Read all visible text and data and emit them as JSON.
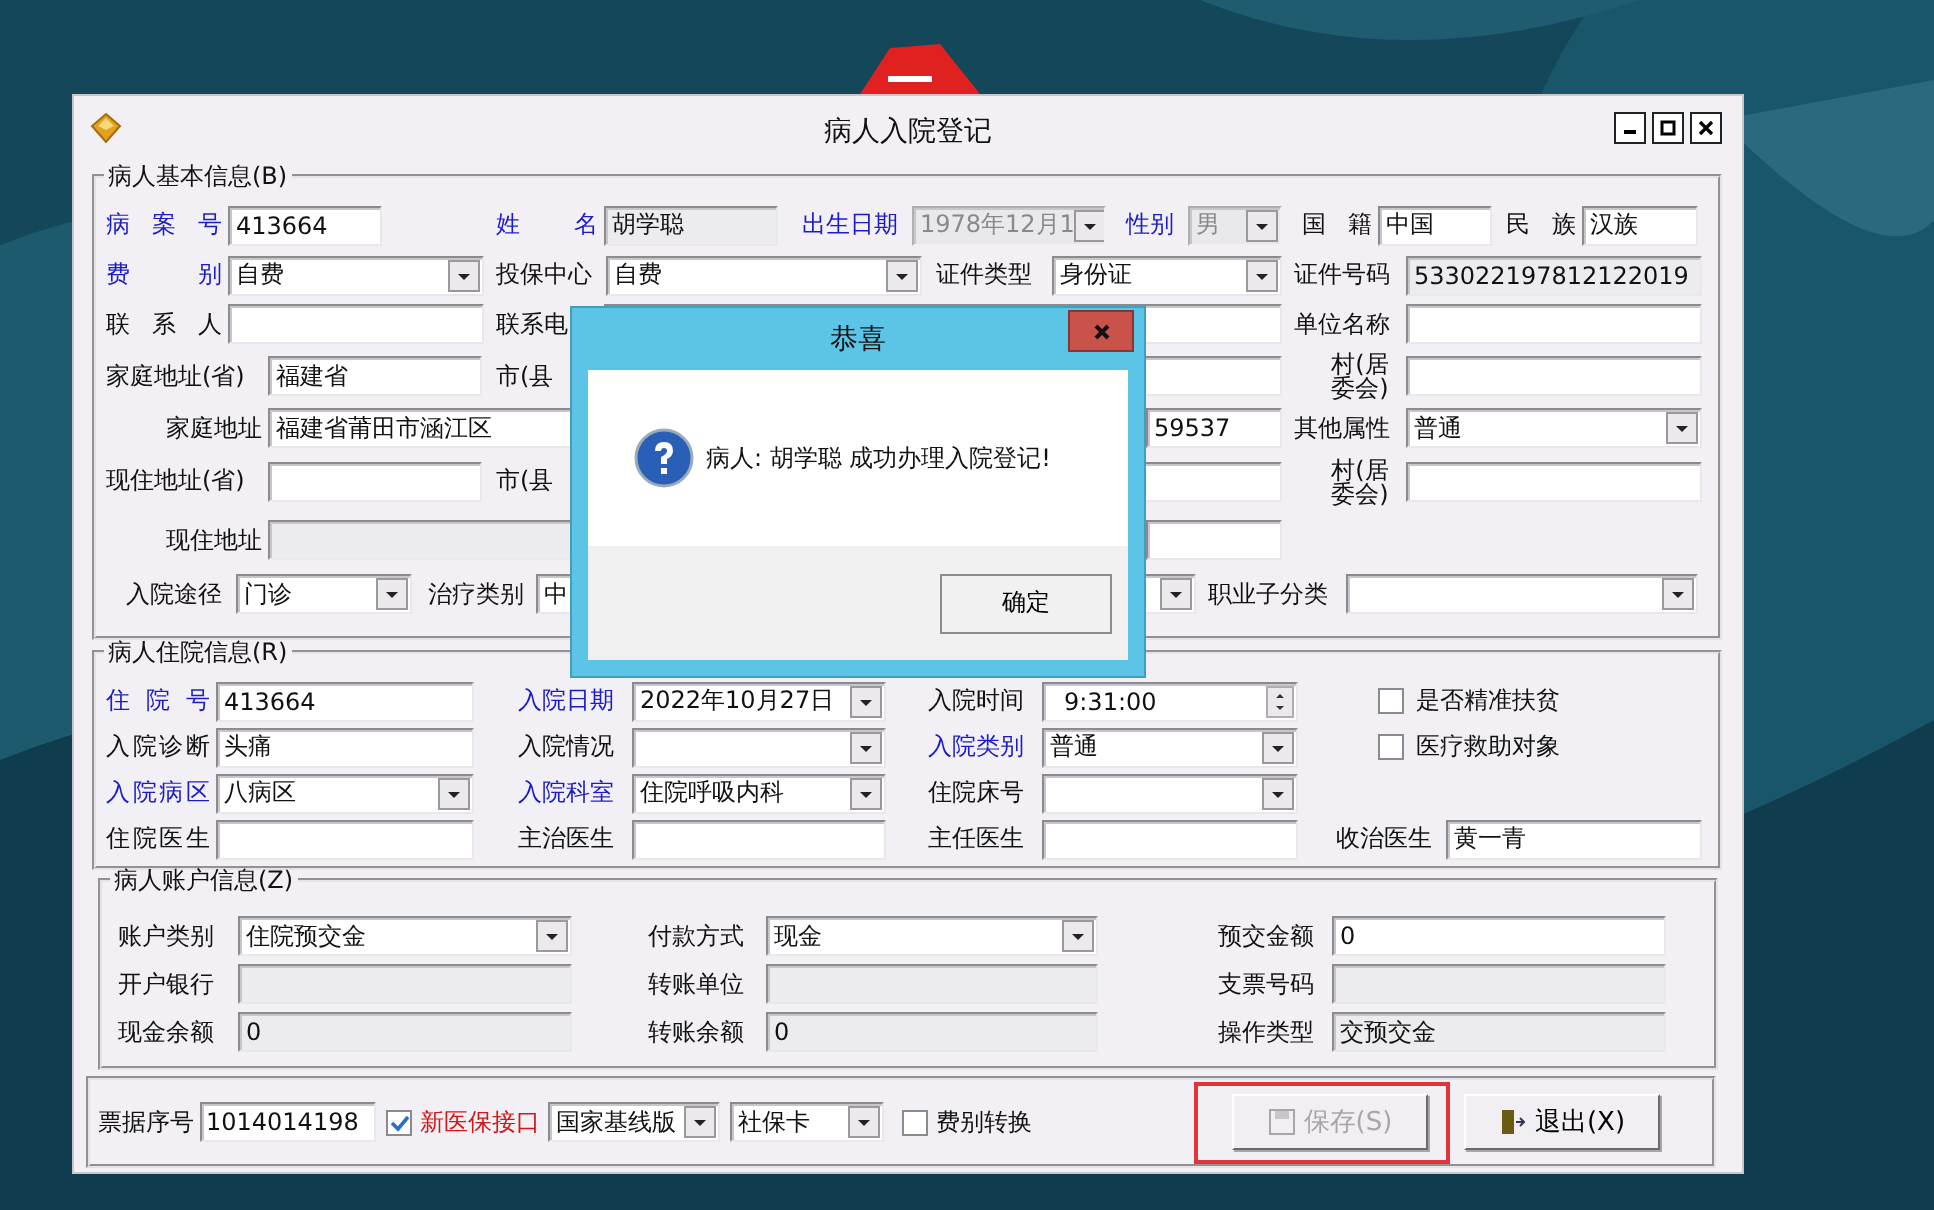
{
  "window": {
    "title": "病人入院登记"
  },
  "basic_info": {
    "title": "病人基本信息(B)",
    "lines": [
      {
        "fields": [
          {
            "label": "病 案 号",
            "highlighted": true,
            "kind": "text",
            "value": "413664",
            "readonly": false,
            "disabled": false
          },
          {
            "label": "姓 名",
            "highlighted": true,
            "kind": "text",
            "value": "胡学聪",
            "readonly": true,
            "disabled": false
          },
          {
            "label": "出生日期",
            "highlighted": true,
            "kind": "combo",
            "value": "1978年12月1",
            "readonly": false,
            "disabled": true
          },
          {
            "label": "性别",
            "highlighted": true,
            "kind": "combo",
            "value": "男",
            "readonly": false,
            "disabled": true
          },
          {
            "label": "国 籍",
            "highlighted": false,
            "kind": "text",
            "value": "中国",
            "readonly": false,
            "disabled": false
          },
          {
            "label": "民 族",
            "highlighted": false,
            "kind": "text",
            "value": "汉族",
            "readonly": false,
            "disabled": false
          }
        ]
      },
      {
        "fields": [
          {
            "label": "费 别",
            "highlighted": true,
            "kind": "combo",
            "value": "自费",
            "readonly": false,
            "disabled": false
          },
          {
            "label": "投保中心",
            "highlighted": false,
            "kind": "combo",
            "value": "自费",
            "readonly": false,
            "disabled": false
          },
          {
            "label": "证件类型",
            "highlighted": false,
            "kind": "combo",
            "value": "身份证",
            "readonly": false,
            "disabled": false
          },
          {
            "label": "证件号码",
            "highlighted": false,
            "kind": "text",
            "value": "533022197812122019",
            "readonly": true,
            "disabled": false
          }
        ]
      },
      {
        "fields": [
          {
            "label": "联 系 人",
            "highlighted": false,
            "kind": "text",
            "readonly": false,
            "disabled": false
          },
          {
            "label": "联系电",
            "highlighted": false,
            "kind": "text",
            "readonly": false,
            "disabled": false
          },
          {
            "label": "单位名称",
            "highlighted": false,
            "kind": "text",
            "readonly": false,
            "disabled": false
          }
        ]
      },
      {
        "fields": [
          {
            "label": "家庭地址(省)",
            "highlighted": false,
            "kind": "text",
            "value": "福建省",
            "readonly": false,
            "disabled": false
          },
          {
            "label": "市(县",
            "highlighted": false,
            "kind": "text",
            "readonly": false,
            "disabled": false
          },
          {
            "label": "村(居委会)",
            "highlighted": false,
            "kind": "text",
            "readonly": false,
            "disabled": false
          }
        ]
      },
      {
        "fields": [
          {
            "label": "家庭地址",
            "highlighted": false,
            "kind": "text",
            "value": "福建省莆田市涵江区",
            "readonly": false,
            "disabled": false
          },
          {
            "kind": "text",
            "value": "59537",
            "readonly": false,
            "disabled": false
          },
          {
            "label": "其他属性",
            "highlighted": false,
            "kind": "combo",
            "value": "普通",
            "readonly": false,
            "disabled": false
          }
        ]
      },
      {
        "fields": [
          {
            "label": "现住地址(省)",
            "highlighted": false,
            "kind": "text",
            "readonly": false,
            "disabled": false
          },
          {
            "label": "市(县",
            "highlighted": false,
            "kind": "text",
            "readonly": false,
            "disabled": false
          },
          {
            "label": "村(居委会)",
            "highlighted": false,
            "kind": "text",
            "readonly": false,
            "disabled": false
          }
        ]
      },
      {
        "fields": [
          {
            "label": "现住地址",
            "highlighted": false,
            "kind": "text",
            "readonly": true,
            "disabled": false
          },
          {
            "kind": "text",
            "readonly": false,
            "disabled": false
          }
        ]
      },
      {
        "fields": [
          {
            "label": "入院途径",
            "highlighted": false,
            "kind": "combo",
            "value": "门诊",
            "readonly": false,
            "disabled": false
          },
          {
            "label": "治疗类别",
            "highlighted": false,
            "kind": "combo",
            "value": "中",
            "readonly": false,
            "disabled": false
          },
          {
            "label": "职业子分类",
            "highlighted": false,
            "kind": "combo",
            "readonly": false,
            "disabled": false
          }
        ]
      }
    ]
  },
  "stay_info": {
    "title": "病人住院信息(R)",
    "lines": [
      {
        "fields": [
          {
            "label": "住 院 号",
            "highlighted": true,
            "kind": "text",
            "value": "413664",
            "readonly": false,
            "disabled": false
          },
          {
            "label": "入院日期",
            "highlighted": true,
            "kind": "combo",
            "value": "2022年10月27日",
            "readonly": false,
            "disabled": false
          },
          {
            "label": "入院时间",
            "highlighted": false,
            "kind": "spin",
            "value": "9:31:00",
            "readonly": false,
            "disabled": false
          },
          {
            "kind": "checkbox",
            "label": "是否精准扶贫",
            "checked": false
          }
        ]
      },
      {
        "fields": [
          {
            "label": "入院诊断",
            "highlighted": false,
            "kind": "text",
            "value": "头痛",
            "readonly": false,
            "disabled": false
          },
          {
            "label": "入院情况",
            "highlighted": false,
            "kind": "combo",
            "readonly": false,
            "disabled": false
          },
          {
            "label": "入院类别",
            "highlighted": true,
            "kind": "combo",
            "value": "普通",
            "readonly": false,
            "disabled": false
          },
          {
            "kind": "checkbox",
            "label": "医疗救助对象",
            "checked": false
          }
        ]
      },
      {
        "fields": [
          {
            "label": "入院病区",
            "highlighted": true,
            "kind": "combo",
            "value": "八病区",
            "readonly": false,
            "disabled": false
          },
          {
            "label": "入院科室",
            "highlighted": true,
            "kind": "combo",
            "value": "住院呼吸内科",
            "readonly": false,
            "disabled": false
          },
          {
            "label": "住院床号",
            "highlighted": false,
            "kind": "combo",
            "readonly": false,
            "disabled": false
          }
        ]
      },
      {
        "fields": [
          {
            "label": "住院医生",
            "highlighted": false,
            "kind": "text",
            "readonly": false,
            "disabled": false
          },
          {
            "label": "主治医生",
            "highlighted": false,
            "kind": "text",
            "readonly": false,
            "disabled": false
          },
          {
            "label": "主任医生",
            "highlighted": false,
            "kind": "text",
            "readonly": false,
            "disabled": false
          },
          {
            "label": "收治医生",
            "highlighted": false,
            "kind": "text",
            "value": "黄一青",
            "readonly": false,
            "disabled": false
          }
        ]
      }
    ]
  },
  "account_info": {
    "title": "病人账户信息(Z)",
    "lines": [
      {
        "fields": [
          {
            "label": "账户类别",
            "highlighted": false,
            "kind": "combo",
            "value": "住院预交金",
            "readonly": false,
            "disabled": false
          },
          {
            "label": "付款方式",
            "highlighted": false,
            "kind": "combo",
            "value": "现金",
            "readonly": false,
            "disabled": false
          },
          {
            "label": "预交金额",
            "highlighted": false,
            "kind": "text",
            "value": "0",
            "readonly": false,
            "disabled": false
          }
        ]
      },
      {
        "fields": [
          {
            "label": "开户银行",
            "highlighted": false,
            "kind": "text",
            "readonly": true,
            "disabled": false
          },
          {
            "label": "转账单位",
            "highlighted": false,
            "kind": "text",
            "readonly": true,
            "disabled": false
          },
          {
            "label": "支票号码",
            "highlighted": false,
            "kind": "text",
            "readonly": true,
            "disabled": false
          }
        ]
      },
      {
        "fields": [
          {
            "label": "现金余额",
            "highlighted": false,
            "kind": "text",
            "value": "0",
            "readonly": true,
            "disabled": false
          },
          {
            "label": "转账余额",
            "highlighted": false,
            "kind": "text",
            "value": "0",
            "readonly": true,
            "disabled": false
          },
          {
            "label": "操作类型",
            "highlighted": false,
            "kind": "text",
            "value": "交预交金",
            "readonly": true,
            "disabled": false
          }
        ]
      }
    ]
  },
  "footer": {
    "receipt": {
      "label": "票据序号",
      "value": "1014014198"
    },
    "new_insurance": {
      "label": "新医保接口",
      "checked": true
    },
    "version_combo": {
      "value": "国家基线版"
    },
    "card_combo": {
      "value": "社保卡"
    },
    "fee_switch": {
      "label": "费别转换",
      "checked": false
    },
    "save_button": {
      "label": "保存(S)",
      "disabled": true,
      "highlighted": true
    },
    "exit_button": {
      "label": "退出(X)"
    }
  },
  "dialog": {
    "title": "恭喜",
    "message": "病人: 胡学聪 成功办理入院登记!",
    "ok_button": "确定"
  }
}
